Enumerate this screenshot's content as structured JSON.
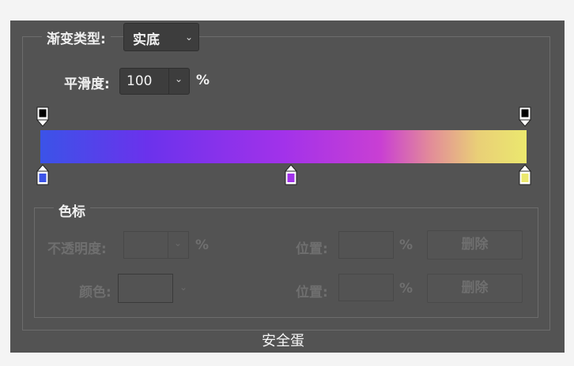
{
  "gradient_type": {
    "label": "渐变类型:",
    "value": "实底"
  },
  "smoothness": {
    "label": "平滑度:",
    "value": "100",
    "unit": "%"
  },
  "gradient": {
    "color_stops": [
      {
        "color": "#3b53e8",
        "location_percent": 0
      },
      {
        "color": "#a232ea",
        "location_percent": 50
      },
      {
        "color": "#ebe86e",
        "location_percent": 100
      }
    ],
    "opacity_stops": [
      {
        "color": "#000000",
        "location_percent": 0
      },
      {
        "color": "#000000",
        "location_percent": 100
      }
    ]
  },
  "stops_section": {
    "label": "色标",
    "opacity_label": "不透明度:",
    "opacity_unit": "%",
    "opacity_location_label": "位置:",
    "opacity_location_unit": "%",
    "opacity_delete": "删除",
    "color_label": "颜色:",
    "color_location_label": "位置:",
    "color_location_unit": "%",
    "color_delete": "删除"
  },
  "caption": "安全蛋"
}
